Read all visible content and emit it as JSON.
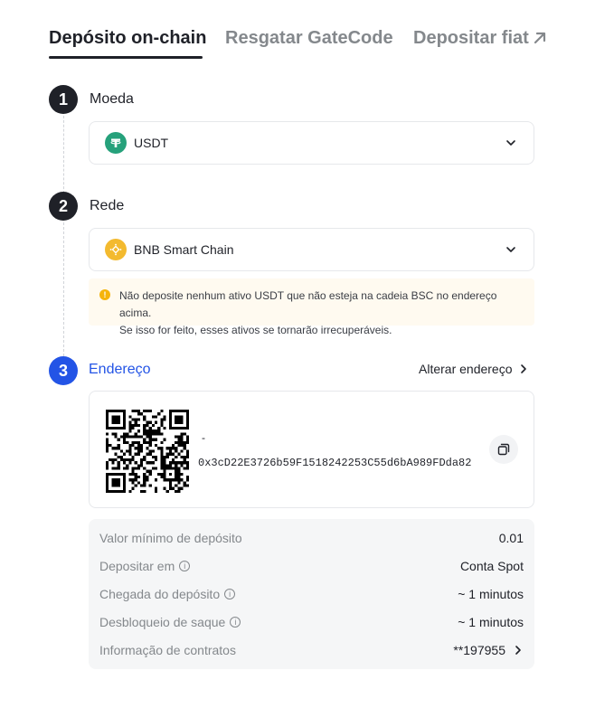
{
  "tabs": [
    {
      "label": "Depósito on-chain",
      "active": true
    },
    {
      "label": "Resgatar GateCode",
      "active": false
    },
    {
      "label": "Depositar fiat",
      "active": false
    }
  ],
  "steps": {
    "coin": {
      "number": "1",
      "label": "Moeda",
      "selected": "USDT",
      "icon": "tether-icon"
    },
    "network": {
      "number": "2",
      "label": "Rede",
      "selected": "BNB Smart Chain",
      "icon": "bnb-icon"
    },
    "address": {
      "number": "3",
      "label": "Endereço",
      "change_label": "Alterar endereço"
    }
  },
  "warning": {
    "line1": "Não deposite nenhum ativo USDT que não esteja na cadeia BSC no endereço acima.",
    "line2": "Se isso for feito, esses ativos se tornarão irrecuperáveis."
  },
  "address": {
    "memo": "-",
    "value": "0x3cD22E3726b59F1518242253C55d6bA989FDda82"
  },
  "info": [
    {
      "label": "Valor mínimo de depósito",
      "value": "0.01",
      "has_info": false,
      "has_chevron": false
    },
    {
      "label": "Depositar em",
      "value": "Conta Spot",
      "has_info": true,
      "has_chevron": false
    },
    {
      "label": "Chegada do depósito",
      "value": "~ 1 minutos",
      "has_info": true,
      "has_chevron": false
    },
    {
      "label": "Desbloqueio de saque",
      "value": "~ 1 minutos",
      "has_info": true,
      "has_chevron": false
    },
    {
      "label": "Informação de contratos",
      "value": "**197955",
      "has_info": false,
      "has_chevron": true
    }
  ],
  "colors": {
    "primary": "#1f2128",
    "accent_blue": "#2354e6",
    "muted": "#84888c",
    "tether_green": "#26a17b",
    "bnb_yellow": "#f3ba2f",
    "warning_bg": "#fffaf0",
    "warning_icon": "#f5b40c"
  }
}
